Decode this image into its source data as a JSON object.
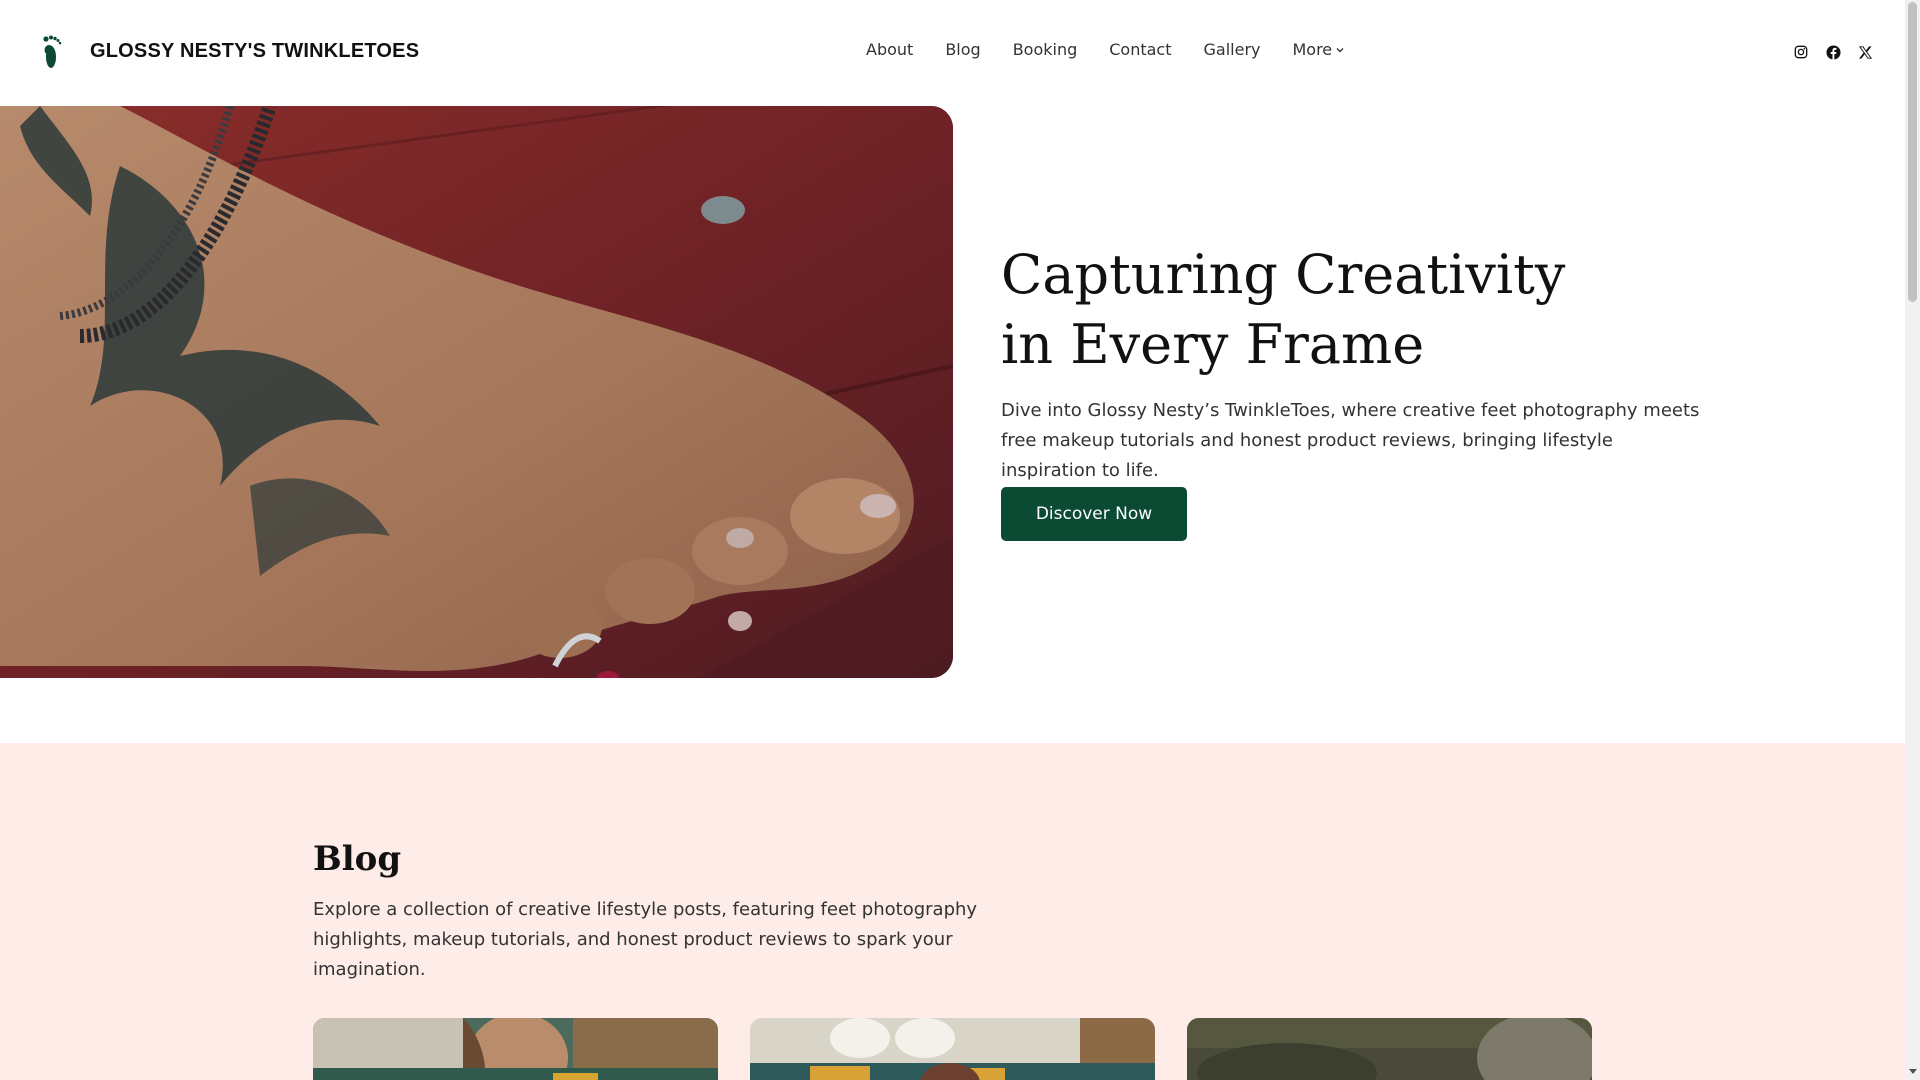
{
  "header": {
    "site_title": "GLOSSY NESTY'S TWINKLETOES",
    "logo_icon": "footprint-icon",
    "nav": [
      {
        "label": "About"
      },
      {
        "label": "Blog"
      },
      {
        "label": "Booking"
      },
      {
        "label": "Contact"
      },
      {
        "label": "Gallery"
      },
      {
        "label": "More"
      }
    ],
    "social_icons": [
      "instagram-icon",
      "facebook-icon",
      "x-icon"
    ]
  },
  "hero": {
    "title_line1": "Capturing Creativity",
    "title_line2": "in Every Frame",
    "description": "Dive into Glossy Nesty’s TwinkleToes, where creative feet photography meets free makeup tutorials and honest product reviews, bringing lifestyle inspiration to life.",
    "cta_label": "Discover Now",
    "image_subject": "tattooed foot with anklet and toe ring on red wooden bench"
  },
  "blog": {
    "title": "Blog",
    "description": "Explore a collection of creative lifestyle posts, featuring feet photography highlights, makeup tutorials, and honest product reviews to spark your imagination."
  },
  "colors": {
    "accent": "#0b4a33",
    "blog_background": "#fdece8",
    "text": "#1e1e1e"
  }
}
